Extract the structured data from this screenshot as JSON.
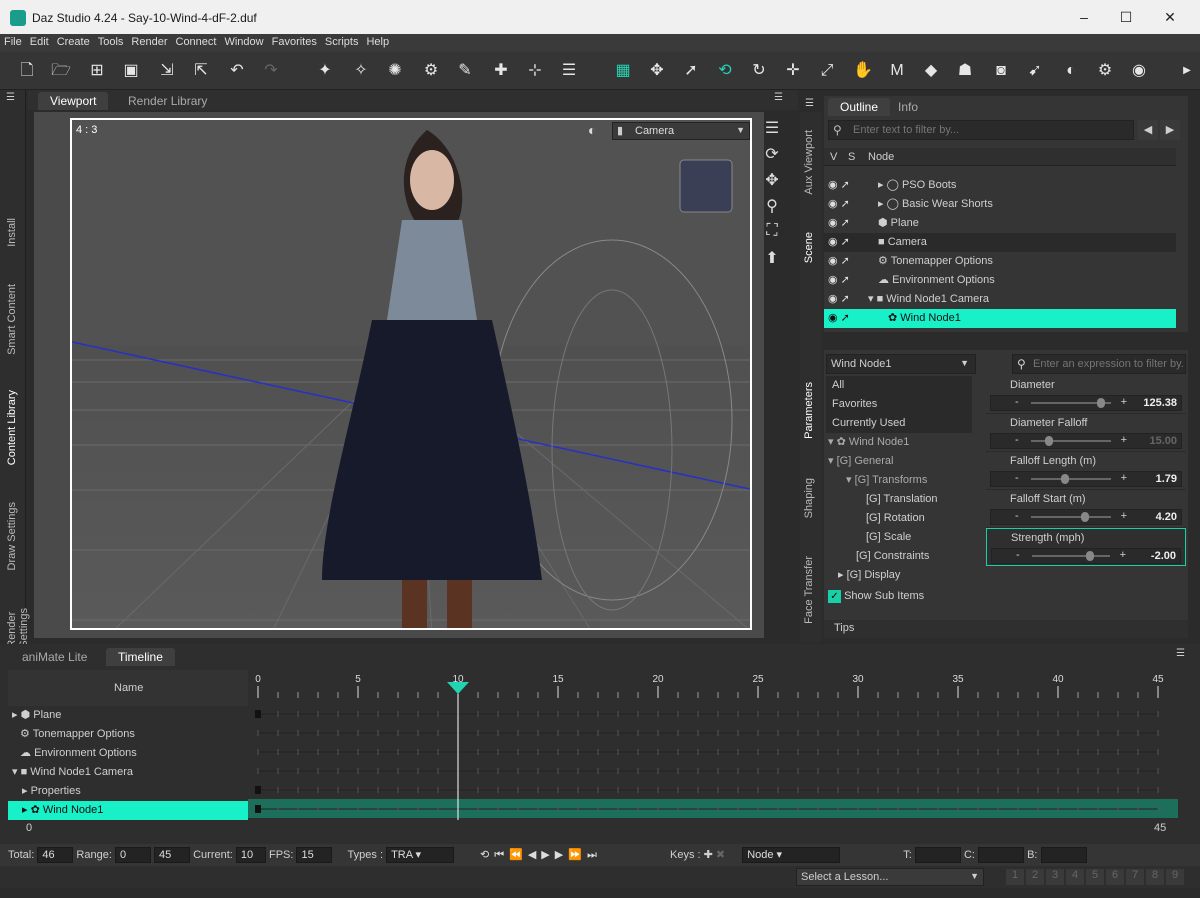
{
  "title_bar": {
    "app_title": "Daz Studio 4.24 - Say-10-Wind-4-dF-2.duf",
    "minimize": "–",
    "maximize": "☐",
    "close": "✕"
  },
  "menu": [
    "File",
    "Edit",
    "Create",
    "Tools",
    "Render",
    "Connect",
    "Window",
    "Favorites",
    "Scripts",
    "Help"
  ],
  "toolbar_icons": [
    "new-file",
    "open-file",
    "merge-file",
    "save-file",
    "import",
    "export",
    "undo",
    "redo",
    "new-figure",
    "joint-editor",
    "node-weight",
    "geometry-editor",
    "spotlight",
    "point-light",
    "distant-light",
    "aux-viewport",
    "rotate-view",
    "select",
    "universal-tool",
    "rotate",
    "translate",
    "scale",
    "pose-tool",
    "morph-tool",
    "pinning",
    "figure-setup",
    "camera-cube",
    "active-pose",
    "region-nav",
    "render-settings",
    "render"
  ],
  "viewport": {
    "tabs": [
      "Viewport",
      "Render Library"
    ],
    "aspect": "4 : 3",
    "camera": "Camera"
  },
  "left_tabs": [
    "Install",
    "Smart Content",
    "Content Library",
    "Draw Settings",
    "Render Settings"
  ],
  "scene": {
    "tabs": [
      "Outline",
      "Info"
    ],
    "filter_placeholder": "Enter text to filter by...",
    "col_v": "V",
    "col_s": "S",
    "col_node": "Node",
    "nodes": [
      {
        "label": "PSO Boots"
      },
      {
        "label": "Basic Wear Shorts"
      },
      {
        "label": "Plane"
      },
      {
        "label": "Camera"
      },
      {
        "label": "Tonemapper Options"
      },
      {
        "label": "Environment Options"
      },
      {
        "label": "Wind Node1 Camera"
      },
      {
        "label": "Wind Node1"
      }
    ]
  },
  "right_tabs": [
    "Aux Viewport",
    "Scene",
    "Parameters",
    "Shaping",
    "Face Transfer"
  ],
  "params": {
    "node": "Wind Node1",
    "filter_placeholder": "Enter an expression to filter by...",
    "tree": [
      {
        "label": "All"
      },
      {
        "label": "Favorites"
      },
      {
        "label": "Currently Used"
      },
      {
        "label": "Wind Node1"
      },
      {
        "label": "General"
      },
      {
        "label": "Transforms"
      },
      {
        "label": "Translation"
      },
      {
        "label": "Rotation"
      },
      {
        "label": "Scale"
      },
      {
        "label": "Constraints"
      },
      {
        "label": "Display"
      }
    ],
    "show_sub": "Show Sub Items",
    "props": [
      {
        "name": "Diameter",
        "value": "125.38",
        "pos": 0.55
      },
      {
        "name": "Diameter Falloff",
        "value": "15.00",
        "pos": 0.12
      },
      {
        "name": "Falloff Length (m)",
        "value": "1.79",
        "pos": 0.25
      },
      {
        "name": "Falloff Start (m)",
        "value": "4.20",
        "pos": 0.42
      },
      {
        "name": "Strength (mph)",
        "value": "-2.00",
        "pos": 0.45
      }
    ],
    "tips": "Tips"
  },
  "timeline": {
    "tabs": [
      "aniMate Lite",
      "Timeline"
    ],
    "name_header": "Name",
    "ticks": [
      "0",
      "5",
      "10",
      "15",
      "20",
      "25",
      "30",
      "35",
      "40",
      "45"
    ],
    "tracks": [
      {
        "label": "Plane"
      },
      {
        "label": "Tonemapper Options"
      },
      {
        "label": "Environment Options"
      },
      {
        "label": "Wind Node1 Camera"
      },
      {
        "label": "Properties"
      },
      {
        "label": "Wind Node1"
      }
    ],
    "range_start": "0",
    "range_end": "45",
    "current_frame": 10,
    "last_frame": 45
  },
  "status": {
    "total_label": "Total:",
    "total": "46",
    "range_label": "Range:",
    "range_start": "0",
    "range_end": "45",
    "current_label": "Current:",
    "current": "10",
    "fps_label": "FPS:",
    "fps": "15",
    "types_label": "Types :",
    "types": "TRA",
    "keys_label": "Keys :",
    "keys_mode": "Node",
    "t_label": "T:",
    "c_label": "C:",
    "b_label": "B:"
  },
  "lesson": {
    "placeholder": "Select a Lesson...",
    "pages": [
      "1",
      "2",
      "3",
      "4",
      "5",
      "6",
      "7",
      "8",
      "9"
    ]
  },
  "colors": {
    "accent": "#18f0c8",
    "background": "#2b2b2b"
  }
}
